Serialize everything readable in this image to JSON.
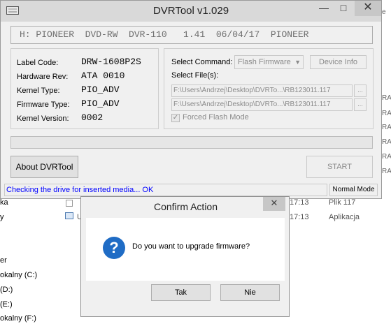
{
  "background": {
    "sidebar_items": [
      "ka",
      "y",
      "er",
      "okalny (C:)",
      "(D:)",
      "(E:)",
      "okalny (F:)"
    ],
    "file_rows": [
      {
        "name": "",
        "time": "17:13",
        "type": "Plik 117"
      },
      {
        "name": "U",
        "time": "17:13",
        "type": "Aplikacja"
      }
    ],
    "right_edge": [
      "e",
      "RA",
      "RA",
      "RA",
      "RA",
      "RA",
      "RA"
    ]
  },
  "main_window": {
    "title": "DVRTool v1.029",
    "minimize": "—",
    "maximize": "□",
    "close": "✕",
    "drive_line": "H: PIONEER  DVD-RW  DVR-110   1.41  06/04/17  PIONEER",
    "info": [
      {
        "label": "Label Code:",
        "value": "DRW-1608P2S"
      },
      {
        "label": "Hardware Rev:",
        "value": "ATA 0010"
      },
      {
        "label": "Kernel Type:",
        "value": "PIO_ADV"
      },
      {
        "label": "Firmware Type:",
        "value": "PIO_ADV"
      },
      {
        "label": "Kernel Version:",
        "value": "0002"
      }
    ],
    "select_command_label": "Select Command:",
    "select_command_value": "Flash Firmware",
    "device_info_button": "Device Info",
    "select_files_label": "Select File(s):",
    "file1": "F:\\Users\\Andrzej\\Desktop\\DVRTo...\\RB123011.117",
    "file2": "F:\\Users\\Andrzej\\Desktop\\DVRTo...\\RB123011.117",
    "browse_label": "...",
    "forced_flash_label": "Forced Flash Mode",
    "forced_flash_checked": true,
    "progress": 0,
    "about_button": "About DVRTool",
    "start_button": "START",
    "status_text": "Checking the drive for inserted media... OK",
    "mode_text": "Normal Mode"
  },
  "dialog": {
    "title": "Confirm Action",
    "close": "✕",
    "icon": "question-icon",
    "message": "Do you want to upgrade firmware?",
    "yes_button": "Tak",
    "no_button": "Nie"
  },
  "colors": {
    "status_text": "#0000ff",
    "question_icon": "#1f6cc5",
    "progress_fill": "#06b025"
  }
}
